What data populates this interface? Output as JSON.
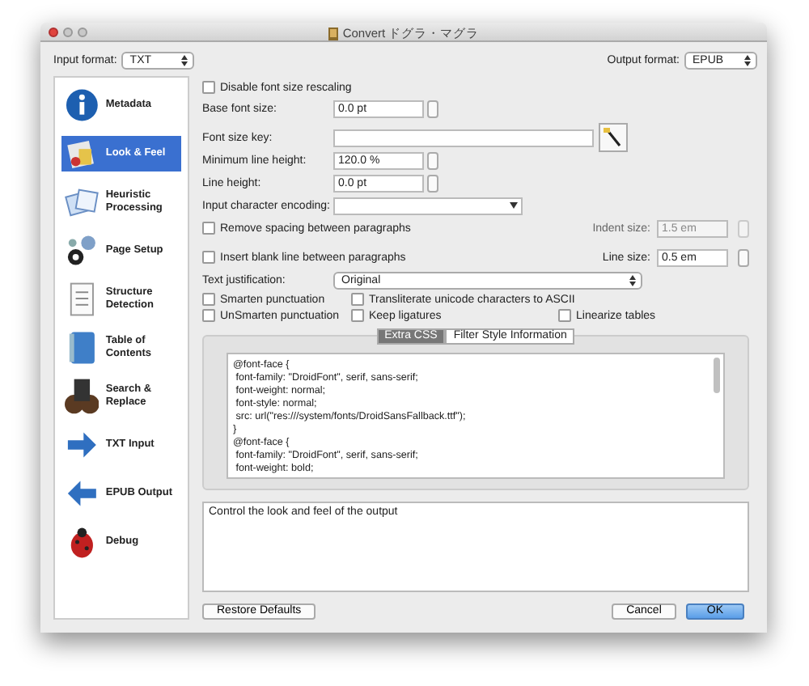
{
  "window": {
    "title": "Convert ドグラ・マグラ"
  },
  "input_format": {
    "label": "Input format:",
    "value": "TXT"
  },
  "output_format": {
    "label": "Output format:",
    "value": "EPUB"
  },
  "sidebar": {
    "items": [
      {
        "label": "Metadata",
        "selected": false
      },
      {
        "label": "Look & Feel",
        "selected": true
      },
      {
        "label": "Heuristic Processing",
        "selected": false
      },
      {
        "label": "Page Setup",
        "selected": false
      },
      {
        "label": "Structure Detection",
        "selected": false
      },
      {
        "label": "Table of Contents",
        "selected": false
      },
      {
        "label": "Search & Replace",
        "selected": false
      },
      {
        "label": "TXT Input",
        "selected": false
      },
      {
        "label": "EPUB Output",
        "selected": false
      },
      {
        "label": "Debug",
        "selected": false
      }
    ]
  },
  "disable_font_rescaling": {
    "label": "Disable font size rescaling",
    "checked": false
  },
  "base_font_size": {
    "label": "Base font size:",
    "value": "0.0 pt"
  },
  "font_size_key": {
    "label": "Font size key:"
  },
  "minimum_line_height": {
    "label": "Minimum line height:",
    "value": "120.0 %"
  },
  "line_height": {
    "label": "Line height:",
    "value": "0.0 pt"
  },
  "input_encoding": {
    "label": "Input character encoding:"
  },
  "remove_spacing": {
    "label": "Remove spacing between paragraphs",
    "checked": false,
    "size_label": "Indent size:",
    "size_value": "1.5 em",
    "size_disabled": true
  },
  "insert_blank_line": {
    "label": "Insert blank line between paragraphs",
    "checked": false,
    "size_label": "Line size:",
    "size_value": "0.5 em",
    "size_disabled": false
  },
  "text_justification": {
    "label": "Text justification:",
    "value": "Original"
  },
  "checkboxes": [
    {
      "label": "Smarten punctuation",
      "checked": false
    },
    {
      "label": "Transliterate unicode characters to ASCII",
      "checked": false
    },
    {
      "label": "UnSmarten punctuation",
      "checked": false
    },
    {
      "label": "Keep ligatures",
      "checked": false
    },
    {
      "label": "Linearize tables",
      "checked": false
    }
  ],
  "css_tabs": [
    {
      "label": "Extra CSS",
      "selected": true
    },
    {
      "label": "Filter Style Information",
      "selected": false
    }
  ],
  "extra_css": {
    "lines": [
      "@font-face {",
      " font-family: \"DroidFont\", serif, sans-serif;",
      " font-weight: normal;",
      " font-style: normal;",
      " src: url(\"res:///system/fonts/DroidSansFallback.ttf\");",
      "}",
      "@font-face {",
      " font-family: \"DroidFont\", serif, sans-serif;",
      " font-weight: bold;"
    ]
  },
  "description": "Control the look and feel of the output",
  "buttons": [
    {
      "label": "Restore Defaults",
      "default": false
    },
    {
      "label": "Cancel",
      "default": false
    },
    {
      "label": "OK",
      "default": true
    }
  ]
}
